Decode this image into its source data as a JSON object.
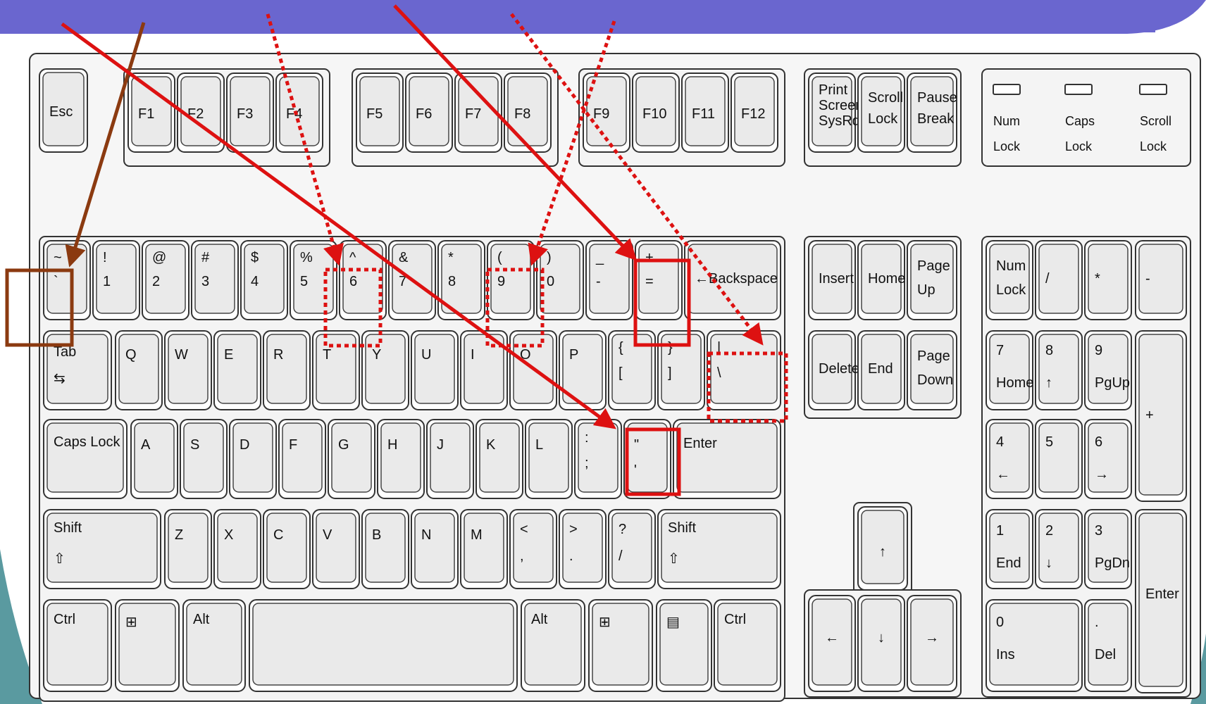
{
  "colors": {
    "header": "#6a66cf",
    "teal": "#5a9aa0",
    "highlight_red": "#dd1111",
    "highlight_brown": "#8b3a10",
    "key_face": "#eaeaea",
    "key_border": "#333333"
  },
  "keys": {
    "esc": "Esc",
    "f1": "F1",
    "f2": "F2",
    "f3": "F3",
    "f4": "F4",
    "f5": "F5",
    "f6": "F6",
    "f7": "F7",
    "f8": "F8",
    "f9": "F9",
    "f10": "F10",
    "f11": "F11",
    "f12": "F12",
    "print_screen": [
      "Print",
      "Screen",
      "SysRq"
    ],
    "scroll_lock": [
      "Scroll",
      "Lock"
    ],
    "pause_break": [
      "Pause",
      "Break"
    ],
    "indicators": [
      [
        "Num",
        "Lock"
      ],
      [
        "Caps",
        "Lock"
      ],
      [
        "Scroll",
        "Lock"
      ]
    ],
    "number_row": [
      [
        "~",
        "`"
      ],
      [
        "!",
        "1"
      ],
      [
        "@",
        "2"
      ],
      [
        "#",
        "3"
      ],
      [
        "$",
        "4"
      ],
      [
        "%",
        "5"
      ],
      [
        "^",
        "6"
      ],
      [
        "&",
        "7"
      ],
      [
        "*",
        "8"
      ],
      [
        "(",
        "9"
      ],
      [
        ")",
        "0"
      ],
      [
        "_",
        "-"
      ],
      [
        "+",
        "="
      ]
    ],
    "backspace": "←Backspace",
    "tab": "Tab",
    "qwerty_row": [
      "Q",
      "W",
      "E",
      "R",
      "T",
      "Y",
      "U",
      "I",
      "O",
      "P"
    ],
    "brackets": [
      [
        "{",
        "["
      ],
      [
        "}",
        "]"
      ],
      [
        "|",
        "\\"
      ]
    ],
    "caps_lock": "Caps Lock",
    "home_row": [
      "A",
      "S",
      "D",
      "F",
      "G",
      "H",
      "J",
      "K",
      "L"
    ],
    "semicolon": [
      ":",
      ";"
    ],
    "quote": [
      "\"",
      "'"
    ],
    "enter": "Enter",
    "shift": "Shift",
    "bottom_row": [
      "Z",
      "X",
      "C",
      "V",
      "B",
      "N",
      "M"
    ],
    "punct": [
      [
        "<",
        ","
      ],
      [
        ">",
        "."
      ],
      [
        "?",
        "/"
      ]
    ],
    "ctrl": "Ctrl",
    "alt": "Alt",
    "insert": "Insert",
    "home": "Home",
    "page_up": [
      "Page",
      "Up"
    ],
    "delete": "Delete",
    "end": "End",
    "page_down": [
      "Page",
      "Down"
    ],
    "numpad": {
      "num_lock": [
        "Num",
        "Lock"
      ],
      "slash": "/",
      "star": "*",
      "minus": "-",
      "plus": "+",
      "k7": [
        "7",
        "Home"
      ],
      "k8": [
        "8",
        "↑"
      ],
      "k9": [
        "9",
        "PgUp"
      ],
      "k4": [
        "4",
        "←"
      ],
      "k5": "5",
      "k6": [
        "6",
        "→"
      ],
      "k1": [
        "1",
        "End"
      ],
      "k2": [
        "2",
        "↓"
      ],
      "k3": [
        "3",
        "PgDn"
      ],
      "k0": [
        "0",
        "Ins"
      ],
      "dot": [
        ".",
        "Del"
      ],
      "enter": "Enter"
    },
    "arrows": {
      "up": "↑",
      "down": "↓",
      "left": "←",
      "right": "→"
    }
  }
}
